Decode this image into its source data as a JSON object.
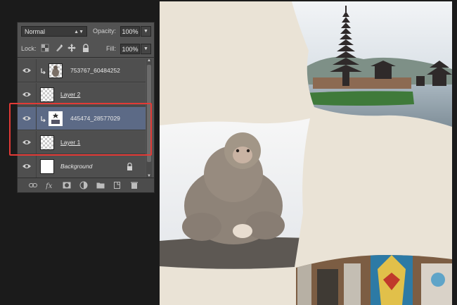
{
  "options": {
    "blend_mode": "Normal",
    "opacity_label": "Opacity:",
    "opacity_value": "100%",
    "lock_label": "Lock:",
    "fill_label": "Fill:",
    "fill_value": "100%"
  },
  "layers": [
    {
      "name": "753767_60484252",
      "clipped": true,
      "underlined": false,
      "italic": false,
      "selected": false
    },
    {
      "name": "Layer 2",
      "clipped": false,
      "underlined": true,
      "italic": false,
      "selected": false
    },
    {
      "name": "445474_28577029",
      "clipped": true,
      "underlined": false,
      "italic": false,
      "selected": true
    },
    {
      "name": "Layer 1",
      "clipped": false,
      "underlined": true,
      "italic": false,
      "selected": false
    },
    {
      "name": "Background",
      "clipped": false,
      "underlined": false,
      "italic": true,
      "selected": false,
      "locked": true
    }
  ],
  "footer_icons": [
    "link-layers-icon",
    "fx-icon",
    "add-mask-icon",
    "adjustment-layer-icon",
    "new-group-icon",
    "new-layer-icon",
    "delete-layer-icon"
  ],
  "colors": {
    "panel": "#535353",
    "selected_layer": "#5c6a86",
    "highlight": "#e23a36",
    "canvas_bg": "#eae3d6"
  }
}
